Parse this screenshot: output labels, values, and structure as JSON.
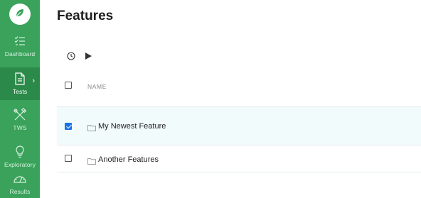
{
  "app": {
    "logo_icon": "leaf-icon",
    "accent": "#3aa25b",
    "active_accent": "#2b8a49"
  },
  "sidebar": {
    "items": [
      {
        "label": "Dashboard",
        "icon": "checklist-icon",
        "active": false
      },
      {
        "label": "Tests",
        "icon": "document-icon",
        "active": true
      },
      {
        "label": "TWS",
        "icon": "tools-icon",
        "active": false
      },
      {
        "label": "Exploratory",
        "icon": "lightbulb-icon",
        "active": false
      },
      {
        "label": "Results",
        "icon": "gauge-icon",
        "active": false
      }
    ]
  },
  "main": {
    "title": "Features",
    "toolbar": {
      "icons": [
        "history-icon",
        "play-icon"
      ]
    },
    "table": {
      "columns": [
        "NAME"
      ],
      "rows": [
        {
          "name": "My Newest Feature",
          "checked": true,
          "icon": "folder-icon"
        },
        {
          "name": "Another Features",
          "checked": false,
          "icon": "folder-icon"
        }
      ]
    }
  }
}
